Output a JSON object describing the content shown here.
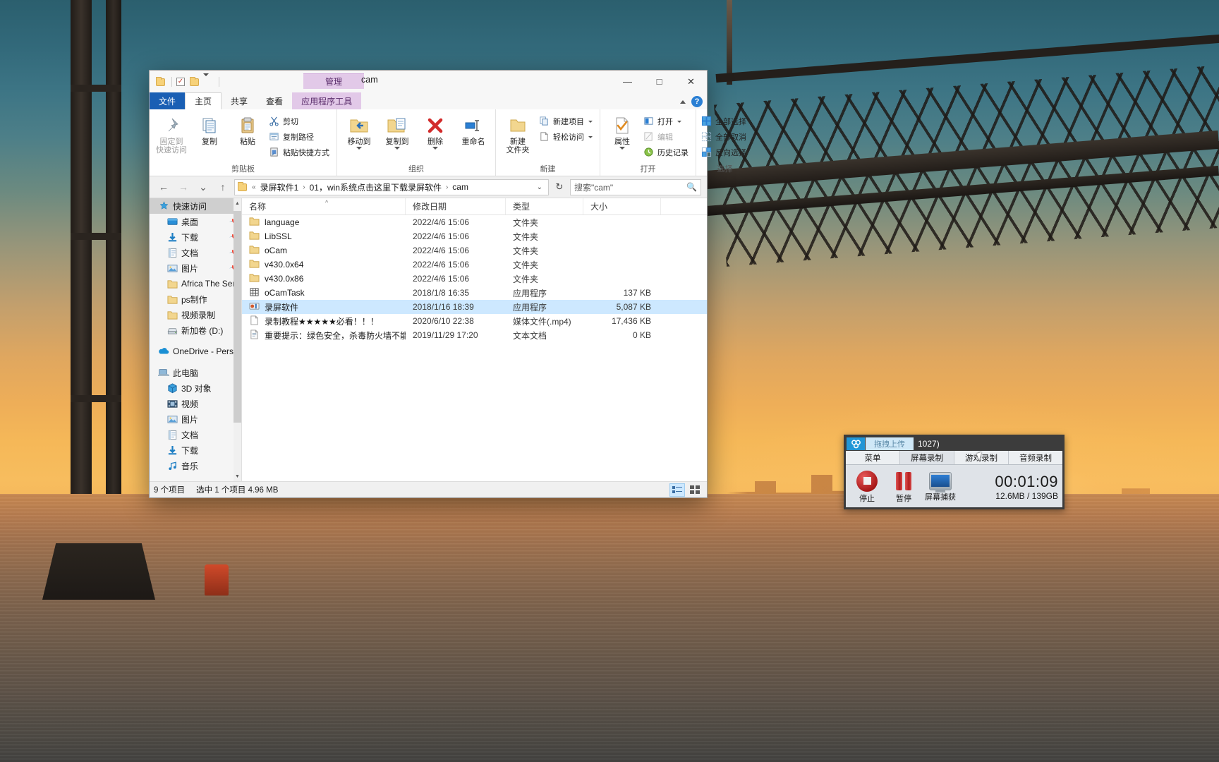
{
  "window": {
    "title": "cam",
    "contextual_tab_group": "管理",
    "quick_access": [
      "folder-icon",
      "properties-checkbox-icon",
      "new-folder-icon",
      "customize-caret-icon"
    ],
    "controls": {
      "minimize": "—",
      "maximize": "□",
      "close": "✕"
    }
  },
  "tabs": [
    {
      "label": "文件",
      "kind": "file"
    },
    {
      "label": "主页",
      "kind": "active"
    },
    {
      "label": "共享",
      "kind": "normal"
    },
    {
      "label": "查看",
      "kind": "normal"
    },
    {
      "label": "应用程序工具",
      "kind": "ctx"
    }
  ],
  "ribbon": {
    "groups": [
      {
        "label": "剪贴板",
        "big": [
          {
            "label": "固定到\n快速访问",
            "icon": "pin-icon",
            "dim": true
          },
          {
            "label": "复制",
            "icon": "copy-icon"
          },
          {
            "label": "粘贴",
            "icon": "paste-icon"
          }
        ],
        "small": [
          {
            "label": "剪切",
            "icon": "scissors-icon"
          },
          {
            "label": "复制路径",
            "icon": "copy-path-icon"
          },
          {
            "label": "粘贴快捷方式",
            "icon": "paste-shortcut-icon"
          }
        ]
      },
      {
        "label": "组织",
        "big": [
          {
            "label": "移动到",
            "icon": "move-to-icon",
            "caret": true
          },
          {
            "label": "复制到",
            "icon": "copy-to-icon",
            "caret": true
          },
          {
            "label": "删除",
            "icon": "delete-icon",
            "caret": true
          },
          {
            "label": "重命名",
            "icon": "rename-icon"
          }
        ],
        "small": []
      },
      {
        "label": "新建",
        "big": [
          {
            "label": "新建\n文件夹",
            "icon": "new-folder-icon"
          }
        ],
        "small": [
          {
            "label": "新建项目",
            "icon": "new-item-icon",
            "caret": true
          },
          {
            "label": "轻松访问",
            "icon": "easy-access-icon",
            "caret": true
          }
        ]
      },
      {
        "label": "打开",
        "big": [
          {
            "label": "属性",
            "icon": "properties-icon",
            "caret": true
          }
        ],
        "small": [
          {
            "label": "打开",
            "icon": "open-icon",
            "caret": true
          },
          {
            "label": "编辑",
            "icon": "edit-icon",
            "disabled": true
          },
          {
            "label": "历史记录",
            "icon": "history-icon"
          }
        ]
      },
      {
        "label": "选择",
        "big": [],
        "small": [
          {
            "label": "全部选择",
            "icon": "select-all-icon"
          },
          {
            "label": "全部取消",
            "icon": "select-none-icon"
          },
          {
            "label": "反向选择",
            "icon": "invert-selection-icon"
          }
        ]
      }
    ],
    "collapse_icon": "chevron-up-icon",
    "help_icon": "help-icon"
  },
  "address": {
    "back": "←",
    "forward": "→",
    "recent": "⌄",
    "up": "↑",
    "breadcrumb_icon": "folder-icon",
    "breadcrumb_prefix": "«",
    "crumbs": [
      "录屏软件1",
      "01，win系统点击这里下载录屏软件",
      "cam"
    ],
    "dropdown": "⌄",
    "refresh": "↻",
    "search_placeholder": "搜索\"cam\"",
    "search_icon": "search-icon"
  },
  "navpane": {
    "items": [
      {
        "label": "快速访问",
        "icon": "star-pin-icon",
        "selected": true,
        "indent": 0
      },
      {
        "label": "桌面",
        "icon": "desktop-icon",
        "indent": 1,
        "pinned": true
      },
      {
        "label": "下载",
        "icon": "download-icon",
        "indent": 1,
        "pinned": true
      },
      {
        "label": "文档",
        "icon": "documents-icon",
        "indent": 1,
        "pinned": true
      },
      {
        "label": "图片",
        "icon": "pictures-icon",
        "indent": 1,
        "pinned": true
      },
      {
        "label": "Africa The Sere",
        "icon": "folder-icon",
        "indent": 1
      },
      {
        "label": "ps制作",
        "icon": "folder-icon",
        "indent": 1
      },
      {
        "label": "视频录制",
        "icon": "folder-icon",
        "indent": 1
      },
      {
        "label": "新加卷 (D:)",
        "icon": "drive-icon",
        "indent": 1
      },
      {
        "label": "OneDrive - Persc",
        "icon": "onedrive-icon",
        "indent": 0
      },
      {
        "label": "此电脑",
        "icon": "this-pc-icon",
        "indent": 0
      },
      {
        "label": "3D 对象",
        "icon": "3d-objects-icon",
        "indent": 1
      },
      {
        "label": "视频",
        "icon": "videos-icon",
        "indent": 1
      },
      {
        "label": "图片",
        "icon": "pictures-icon",
        "indent": 1
      },
      {
        "label": "文档",
        "icon": "documents-icon",
        "indent": 1
      },
      {
        "label": "下载",
        "icon": "download-icon",
        "indent": 1
      },
      {
        "label": "音乐",
        "icon": "music-icon",
        "indent": 1
      }
    ]
  },
  "filelist": {
    "columns": [
      "名称",
      "修改日期",
      "类型",
      "大小"
    ],
    "sort_indicator": "^",
    "rows": [
      {
        "name": "language",
        "date": "2022/4/6 15:06",
        "type": "文件夹",
        "size": "",
        "icon": "folder-icon"
      },
      {
        "name": "LibSSL",
        "date": "2022/4/6 15:06",
        "type": "文件夹",
        "size": "",
        "icon": "folder-icon"
      },
      {
        "name": "oCam",
        "date": "2022/4/6 15:06",
        "type": "文件夹",
        "size": "",
        "icon": "folder-icon"
      },
      {
        "name": "v430.0x64",
        "date": "2022/4/6 15:06",
        "type": "文件夹",
        "size": "",
        "icon": "folder-icon"
      },
      {
        "name": "v430.0x86",
        "date": "2022/4/6 15:06",
        "type": "文件夹",
        "size": "",
        "icon": "folder-icon"
      },
      {
        "name": "oCamTask",
        "date": "2018/1/8 16:35",
        "type": "应用程序",
        "size": "137 KB",
        "icon": "exe-icon"
      },
      {
        "name": "录屏软件",
        "date": "2018/1/16 18:39",
        "type": "应用程序",
        "size": "5,087 KB",
        "icon": "app-icon",
        "selected": true
      },
      {
        "name": "录制教程★★★★★必看！！！",
        "date": "2020/6/10 22:38",
        "type": "媒体文件(.mp4)",
        "size": "17,436 KB",
        "icon": "video-file-icon"
      },
      {
        "name": "重要提示：绿色安全，杀毒防火墙不能识...",
        "date": "2019/11/29 17:20",
        "type": "文本文档",
        "size": "0 KB",
        "icon": "text-file-icon"
      }
    ]
  },
  "statusbar": {
    "item_count": "9 个项目",
    "selection": "选中 1 个项目  4.96 MB",
    "view_details_icon": "details-view-icon",
    "view_tiles_icon": "tiles-view-icon"
  },
  "recorder": {
    "badge_icon": "cloud-upload-icon",
    "pill_label": "拖拽上传",
    "session_id": "1027)",
    "tabs": [
      {
        "label": "菜单",
        "active": false
      },
      {
        "label": "屏幕录制",
        "active": true
      },
      {
        "label": "游戏录制",
        "active": false
      },
      {
        "label": "音频录制",
        "active": false
      }
    ],
    "buttons": [
      {
        "label": "停止",
        "icon": "stop-record-icon"
      },
      {
        "label": "暂停",
        "icon": "pause-record-icon"
      },
      {
        "label": "屏幕捕获",
        "icon": "screen-capture-icon"
      }
    ],
    "elapsed": "00:01:09",
    "size_info": "12.6MB / 139GB"
  },
  "colors": {
    "accent_blue": "#1a5fb4",
    "selection_blue": "#cde8ff",
    "contextual_purple": "#e2c9e8",
    "folder_yellow": "#f7d27a",
    "record_red": "#b31e1e"
  }
}
